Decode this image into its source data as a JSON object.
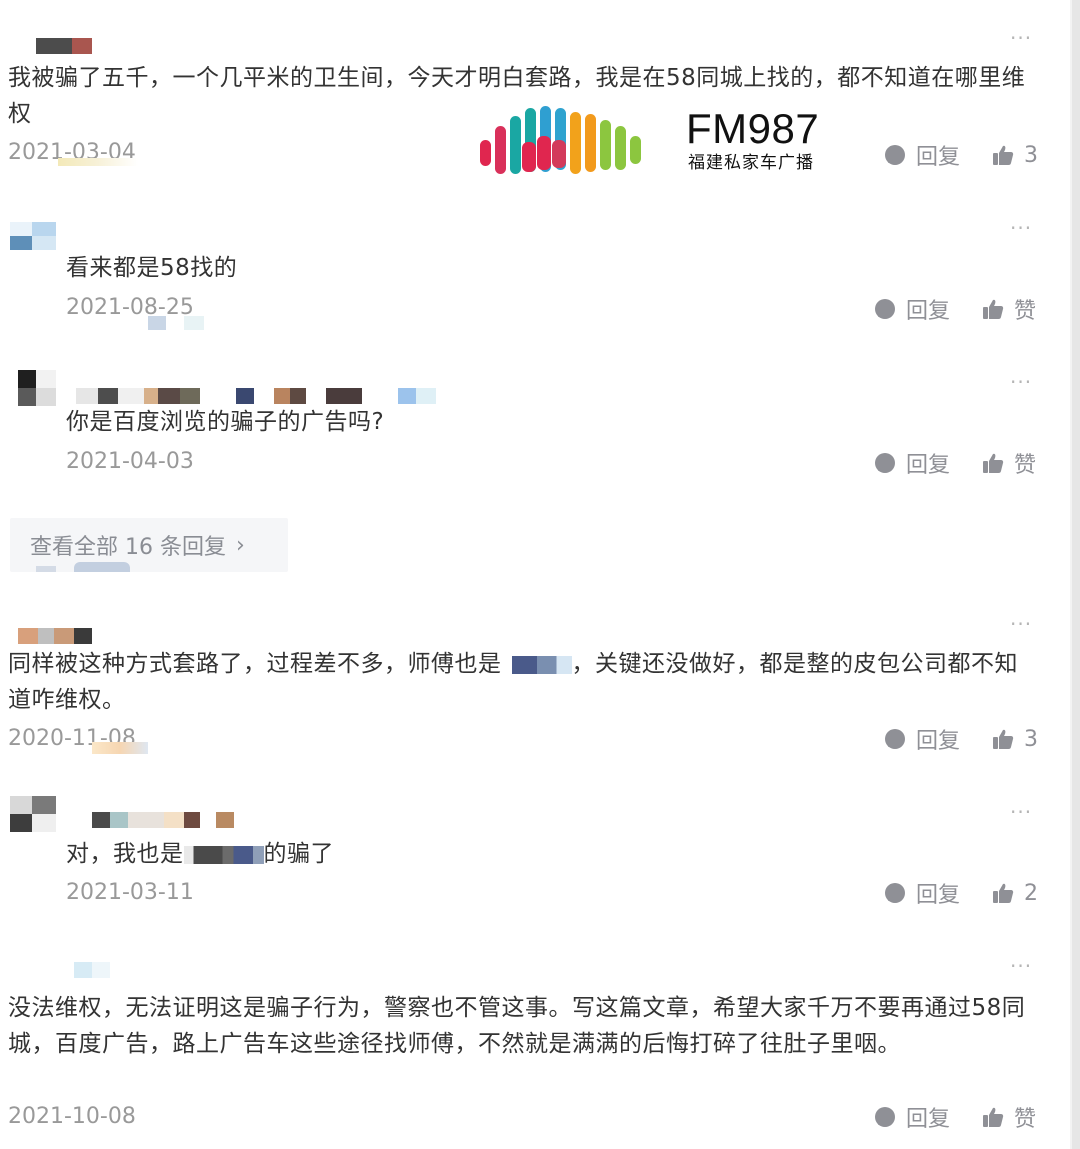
{
  "logo": {
    "title": "FM987",
    "subtitle": "福建私家车广播"
  },
  "actions": {
    "reply_label": "回复",
    "like_label": "赞"
  },
  "more_label": "···",
  "comments": [
    {
      "text": "我被骗了五千，一个几平米的卫生间，今天才明白套路，我是在58同城上找的，都不知道在哪里维权",
      "date": "2021-03-04",
      "likes": "3"
    },
    {
      "text": "看来都是58找的",
      "date": "2021-08-25",
      "likes": "赞"
    },
    {
      "text": "你是百度浏览的骗子的广告吗?",
      "date": "2021-04-03",
      "likes": "赞"
    },
    {
      "text": "同样被这种方式套路了，过程差不多，师傅也是",
      "text_after": "，关键还没做好，都是整的皮包公司都不知道咋维权。",
      "date": "2020-11-08",
      "likes": "3"
    },
    {
      "text": "对，我也是",
      "text_after": "的骗了",
      "date": "2021-03-11",
      "likes": "2"
    },
    {
      "text": "没法维权，无法证明这是骗子行为，警察也不管这事。写这篇文章，希望大家千万不要再通过58同城，百度广告，路上广告车这些途径找师傅，不然就是满满的后悔打碎了往肚子里咽。",
      "date": "2021-10-08",
      "likes": "赞"
    }
  ],
  "view_all": {
    "label": "查看全部 16 条回复"
  },
  "colors": {
    "text": "#333333",
    "date": "#999999",
    "action": "#8f9096",
    "view_all_bg": "#f5f6f8"
  },
  "icons": [
    "more-icon",
    "reply-icon",
    "like-icon",
    "chevron-right-icon",
    "fm987-logo"
  ]
}
